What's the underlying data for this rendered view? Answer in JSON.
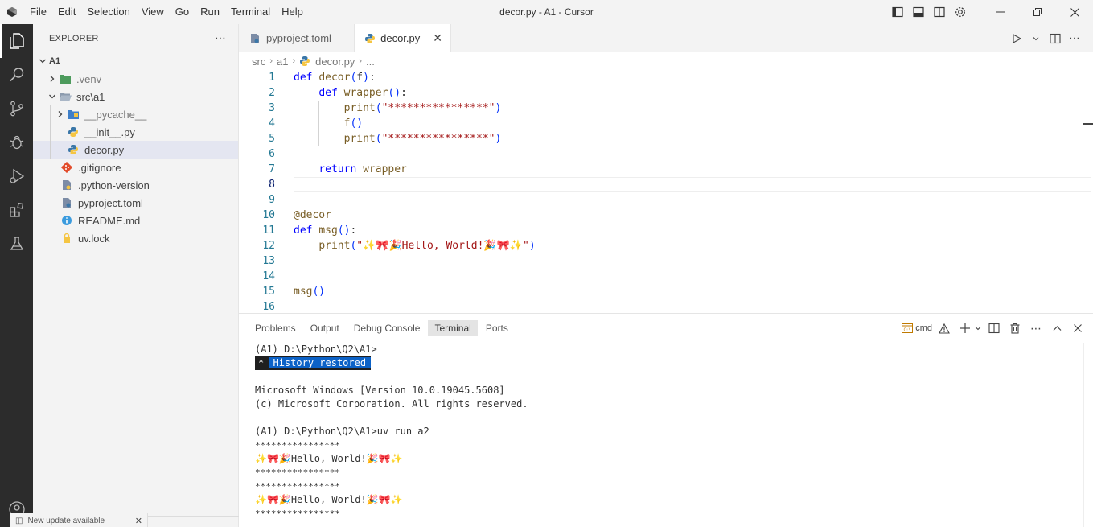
{
  "window": {
    "title": "decor.py - A1 - Cursor",
    "menu": [
      "File",
      "Edit",
      "Selection",
      "View",
      "Go",
      "Run",
      "Terminal",
      "Help"
    ]
  },
  "sidebar": {
    "title": "EXPLORER",
    "root": "A1",
    "items": [
      {
        "label": ".venv",
        "icon": "folder-venv-icon"
      },
      {
        "label": "src\\a1",
        "icon": "folder-open-icon"
      },
      {
        "label": "__pycache__",
        "icon": "folder-pycache-icon"
      },
      {
        "label": "__init__.py",
        "icon": "python-icon"
      },
      {
        "label": "decor.py",
        "icon": "python-icon"
      },
      {
        "label": ".gitignore",
        "icon": "git-icon"
      },
      {
        "label": ".python-version",
        "icon": "settings-file-icon"
      },
      {
        "label": "pyproject.toml",
        "icon": "toml-file-icon"
      },
      {
        "label": "README.md",
        "icon": "info-icon"
      },
      {
        "label": "uv.lock",
        "icon": "lock-icon"
      }
    ],
    "update_notice": "New update available"
  },
  "tabs": [
    {
      "label": "pyproject.toml",
      "active": false
    },
    {
      "label": "decor.py",
      "active": true
    }
  ],
  "breadcrumb": [
    "src",
    "a1",
    "decor.py",
    "..."
  ],
  "code": {
    "line_numbers": [
      "1",
      "2",
      "3",
      "4",
      "5",
      "6",
      "7",
      "8",
      "9",
      "10",
      "11",
      "12",
      "13",
      "14",
      "15",
      "16"
    ],
    "lines": [
      "def decor(f):",
      "    def wrapper():",
      "        print(\"****************\")",
      "        f()",
      "        print(\"****************\")",
      "",
      "    return wrapper",
      "",
      "",
      "@decor",
      "def msg():",
      "    print(\"✨🎀🎉Hello, World!🎉🎀✨\")",
      "",
      "",
      "msg()",
      ""
    ]
  },
  "panel": {
    "tabs": [
      "Problems",
      "Output",
      "Debug Console",
      "Terminal",
      "Ports"
    ],
    "active_tab": "Terminal",
    "shell_label": "cmd",
    "terminal": {
      "prompt1": "(A1) D:\\Python\\Q2\\A1>",
      "history_star": "*",
      "history_msg": "History restored",
      "lines": [
        "",
        "Microsoft Windows [Version 10.0.19045.5608]",
        "(c) Microsoft Corporation. All rights reserved.",
        "",
        "(A1) D:\\Python\\Q2\\A1>uv run a2",
        "****************",
        "✨🎀🎉Hello, World!🎉🎀✨",
        "****************",
        "****************",
        "✨🎀🎉Hello, World!🎉🎀✨",
        "****************"
      ]
    }
  }
}
